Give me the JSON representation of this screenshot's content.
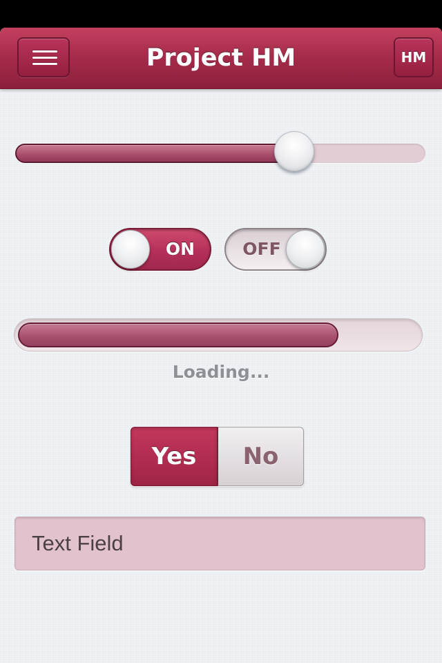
{
  "app": {
    "title": "Project HM"
  },
  "navbar": {
    "menu_icon": "hamburger-menu-icon",
    "title": "Project HM",
    "profile_button_label": "HM"
  },
  "slider": {
    "value_fraction": 0.68
  },
  "toggles": [
    {
      "label": "ON",
      "state": true
    },
    {
      "label": "OFF",
      "state": false
    }
  ],
  "progress": {
    "value_fraction": 0.8,
    "status_text": "Loading..."
  },
  "segmented_control": {
    "options": [
      "Yes",
      "No"
    ],
    "selected": "Yes"
  },
  "text_field": {
    "placeholder": "Text Field",
    "value": ""
  },
  "colors": {
    "accent": "#b02c50",
    "accent_dark": "#7d1c37",
    "background": "#edf0f3",
    "field_fill": "#e2c2cd"
  }
}
